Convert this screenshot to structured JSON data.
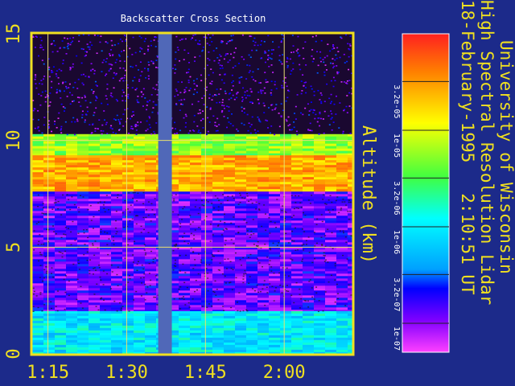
{
  "chart_data": {
    "type": "heatmap",
    "title": "Backscatter Cross Section",
    "ylabel": "Altitude (km)",
    "side_title": [
      "University of Wisconsin",
      "High Spectral Resolution Lidar",
      "18-February-1995   2:10:51 UT"
    ],
    "x_ticks": [
      {
        "label": "1:15",
        "minutes": 75
      },
      {
        "label": "1:30",
        "minutes": 90
      },
      {
        "label": "1:45",
        "minutes": 105
      },
      {
        "label": "2:00",
        "minutes": 120
      }
    ],
    "x_range_minutes": [
      72,
      133
    ],
    "y_ticks": [
      0,
      5,
      10,
      15
    ],
    "ylim": [
      0,
      15
    ],
    "data_gap_minutes": [
      96.0,
      98.6
    ],
    "colorbar": {
      "tick_labels": [
        "3.2e-05",
        "1e-05",
        "3.2e-06",
        "1e-06",
        "3.2e-07",
        "1e-07"
      ],
      "log_range": [
        -7.3,
        -4.0
      ],
      "scale": "log"
    },
    "layers": [
      {
        "name": "cirrus_upper",
        "bottom_km": 9.3,
        "top_km": 10.3,
        "level": 0.62
      },
      {
        "name": "cirrus_core",
        "bottom_km": 7.6,
        "top_km": 9.3,
        "level": 0.82
      },
      {
        "name": "clear_air",
        "bottom_km": 2.0,
        "top_km": 7.6,
        "level": 0.12
      },
      {
        "name": "boundary_layer",
        "bottom_km": 0.0,
        "top_km": 2.0,
        "level": 0.38
      }
    ],
    "grid": true,
    "colors": {
      "background": "#1c2a8a",
      "axis": "#f0e020",
      "gap": "#5068b8",
      "title_text": "#ffffff"
    }
  }
}
